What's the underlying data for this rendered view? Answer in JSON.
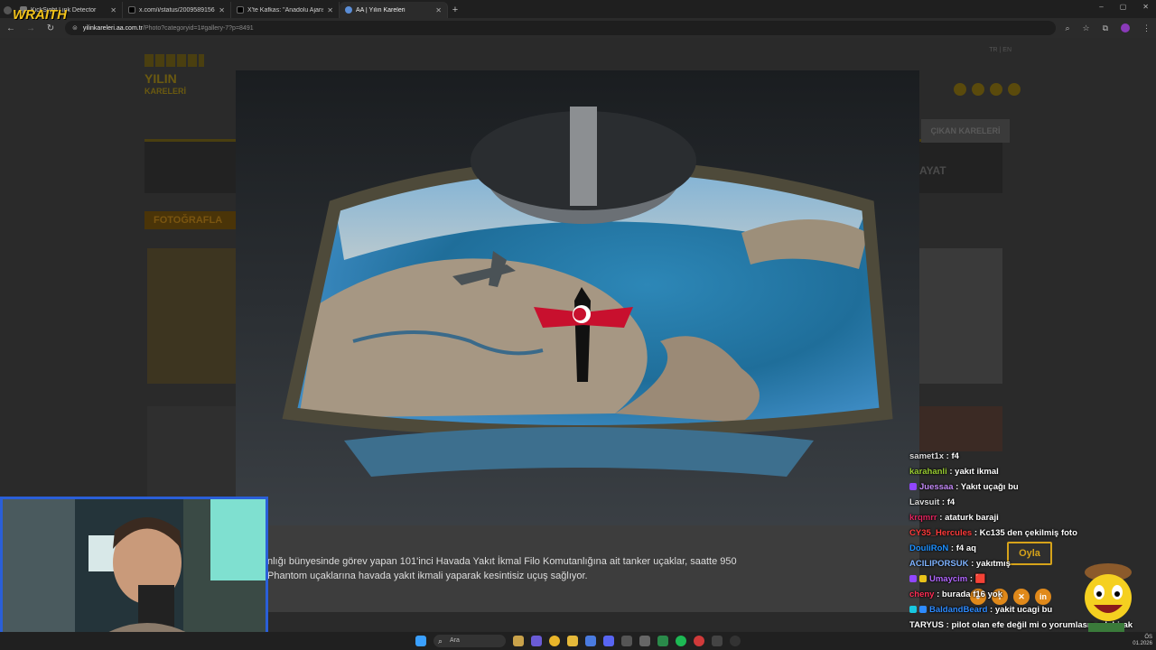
{
  "browser": {
    "tabs": [
      {
        "title": "KickSight Link Detector",
        "active": false
      },
      {
        "title": "x.com/i/status/2009589156869",
        "active": false
      },
      {
        "title": "X'te Kafkas: \"Anadolu Ajansının",
        "active": false
      },
      {
        "title": "AA | Yılın Kareleri",
        "active": true
      }
    ],
    "new_tab": "+",
    "url_domain": "yilinkareleri.aa.com.tr",
    "url_path": "/Photo?categoryid=1#gallery-7?p=8491",
    "window_controls": [
      "–",
      "▢",
      "✕"
    ]
  },
  "site": {
    "logo_line1": "YILIN",
    "logo_line2": "KARELERİ",
    "menu_item": "ÇIKAN KARELERİ",
    "hayat": "AYAT",
    "fotograflar": "FOTOĞRAFLA",
    "lang": "TR | EN"
  },
  "caption": {
    "line1": "nlığı bünyesinde görev yapan 101'inci Havada Yakıt İkmal Filo Komutanlığına ait tanker uçaklar, saatte 950",
    "line2": "Phantom uçaklarına havada yakıt ikmali yaparak kesintisiz uçuş sağlıyor."
  },
  "vote_button": "Oyla",
  "share_buttons": [
    "●",
    "f",
    "✕",
    "in"
  ],
  "chat": [
    {
      "user": "samet1x",
      "text": "f4",
      "color": "#ffffff"
    },
    {
      "user": "karahanli",
      "text": "yakıt ikmal",
      "color": "#9acd32"
    },
    {
      "user": "Juessaa",
      "text": "Yakıt uçağı bu",
      "color": "#c58af9"
    },
    {
      "user": "Lavsuit",
      "text": "f4",
      "color": "#ffffff"
    },
    {
      "user": "krqmrr",
      "text": "ataturk baraji",
      "color": "#e0245e"
    },
    {
      "user": "CY35_Hercules",
      "text": "Kc135 den çekilmiş foto",
      "color": "#ff3b3b"
    },
    {
      "user": "DouliRoN",
      "text": "f4 aq",
      "color": "#1e90ff"
    },
    {
      "user": "ACILIPORSUK",
      "text": "yakıtmış",
      "color": "#7fb3ff"
    },
    {
      "user": "Umaycim",
      "text": "🟥",
      "color": "#b266ff"
    },
    {
      "user": "cheny",
      "text": "burada f16 yok",
      "color": "#ff2d55"
    },
    {
      "user": "BaldandBeard",
      "text": "yakit ucagi bu",
      "color": "#2e8bff"
    },
    {
      "user": "TARYUS",
      "text": "pilot olan efe değil mi o yorumlasın mk birak",
      "color": "#ffffff"
    }
  ],
  "streamer": {
    "overlay_text": "WRAITH"
  },
  "taskbar": {
    "search_placeholder": "Ara",
    "tray_line1": "ÖS",
    "tray_line2": "01.2026"
  },
  "colors": {
    "accent": "#d6a31a",
    "webcam_border": "#2a5fd8"
  }
}
